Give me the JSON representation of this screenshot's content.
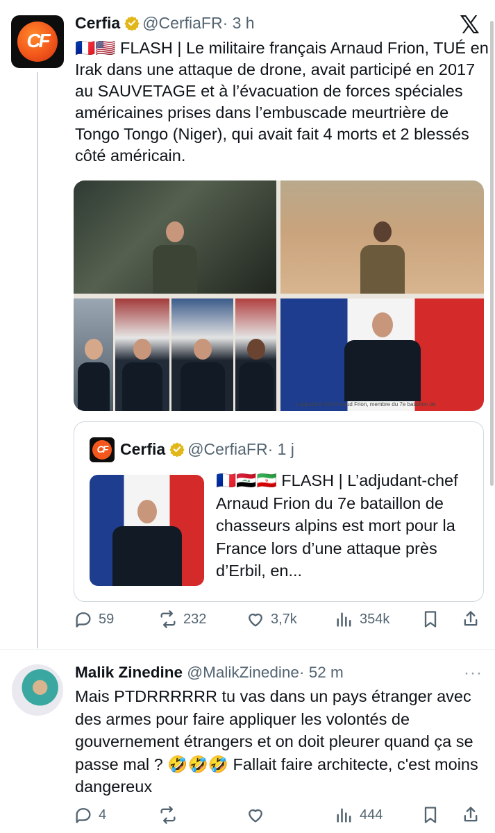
{
  "tweet": {
    "author_name": "Cerfia",
    "author_handle": "@CerfiaFR",
    "time": "· 3 h",
    "avatar_letters": "CF",
    "text": "🇫🇷🇺🇸 FLASH | Le militaire français Arnaud Frion, TUÉ en Irak dans une attaque de drone, avait participé en 2017 au SAUVETAGE et à l’évacuation de forces spéciales américaines prises dans l’embuscade meurtrière de Tongo Tongo (Niger), qui avait fait 4 morts et 2 blessés côté américain.",
    "image_caption": "L’adjudant-chef Arnaud Frion, membre du 7e bataillon de",
    "icons": {
      "platform": "x-logo",
      "verified": "verified-badge-icon"
    },
    "colors": {
      "verified": "#e2b719",
      "muted": "#536471"
    }
  },
  "quote": {
    "author_name": "Cerfia",
    "author_handle": "@CerfiaFR",
    "time": "· 1 j",
    "avatar_letters": "CF",
    "text": "🇫🇷🇮🇶🇮🇷 FLASH | L’adjudant-chef Arnaud Frion du 7e bataillon de chasseurs alpins est mort pour la France lors d’une attaque près d’Erbil, en..."
  },
  "tweet_actions": {
    "replies": "59",
    "reposts": "232",
    "likes": "3,7k",
    "views": "354k"
  },
  "reply": {
    "author_name": "Malik Zinedine",
    "author_handle": "@MalikZinedine",
    "time": "· 52 m",
    "more": "···",
    "text": "Mais PTDRRRRRR tu vas dans un pays étranger avec des armes pour faire appliquer les volontés de gouvernement étrangers et on doit pleurer quand ça se passe mal ? 🤣🤣🤣 Fallait faire architecte, c'est moins dangereux"
  },
  "reply_actions": {
    "replies": "4",
    "reposts": "",
    "likes": "",
    "views": "444"
  }
}
